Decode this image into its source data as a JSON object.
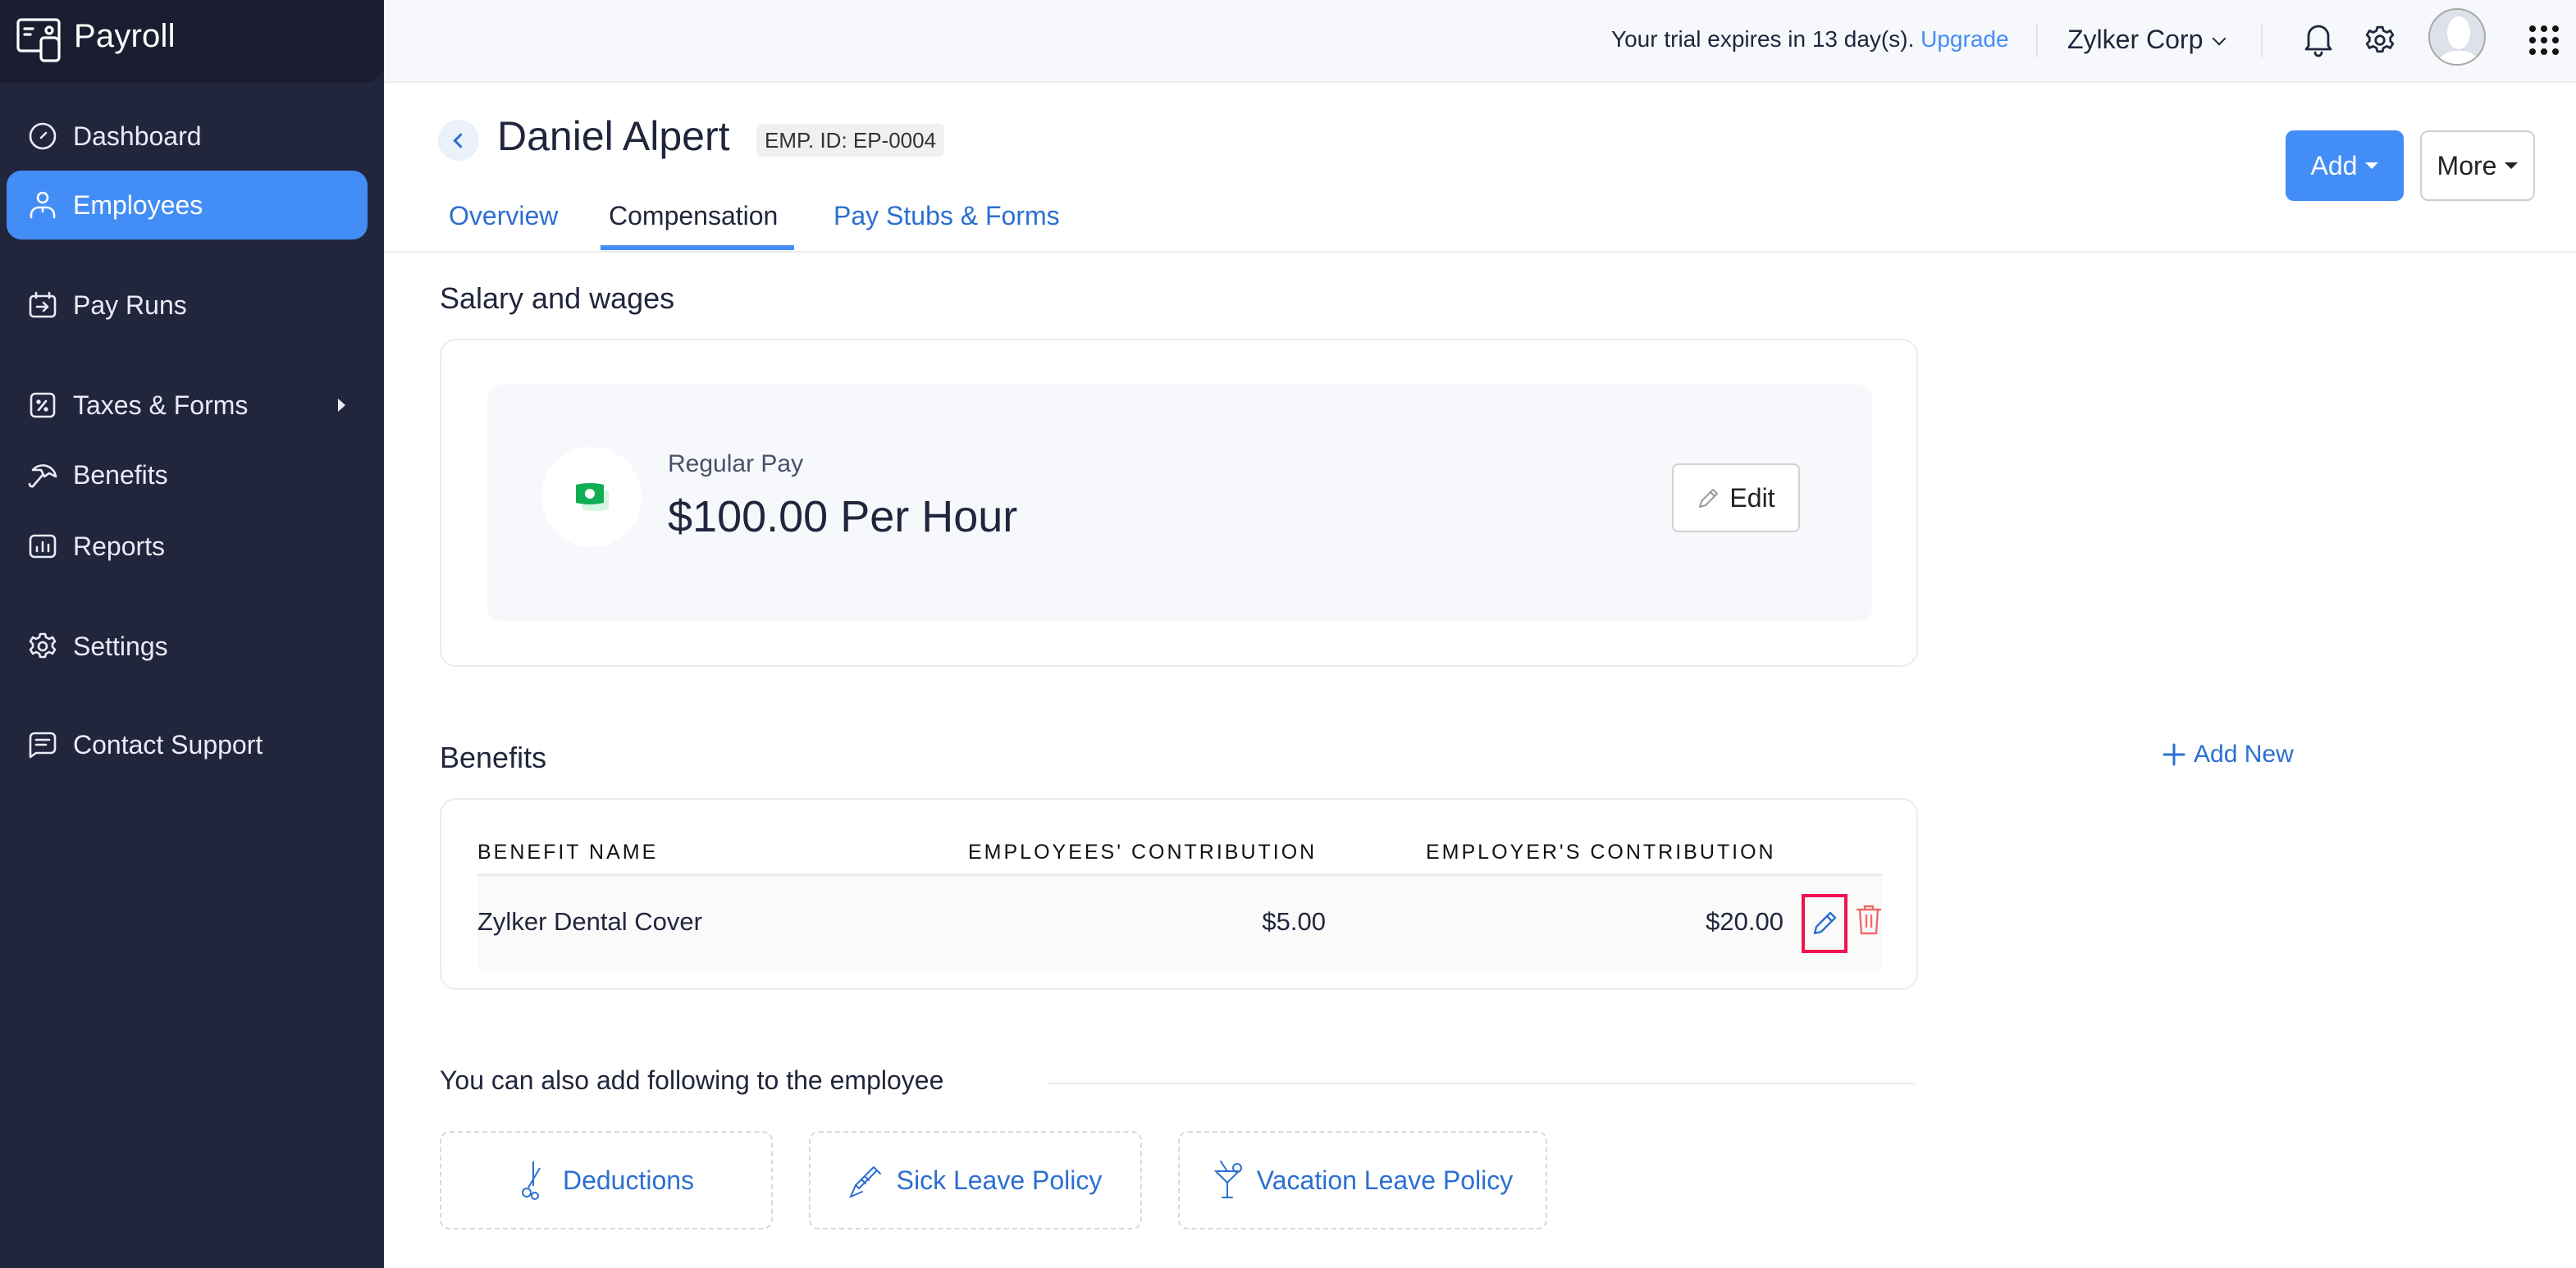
{
  "app": {
    "name": "Payroll"
  },
  "sidebar": {
    "items": [
      {
        "label": "Dashboard",
        "icon": "dashboard-icon"
      },
      {
        "label": "Employees",
        "icon": "person-icon",
        "active": true
      },
      {
        "label": "Pay Runs",
        "icon": "pay-runs-icon"
      },
      {
        "label": "Taxes & Forms",
        "icon": "percent-icon",
        "has_submenu": true
      },
      {
        "label": "Benefits",
        "icon": "umbrella-icon"
      },
      {
        "label": "Reports",
        "icon": "bar-chart-icon"
      },
      {
        "label": "Settings",
        "icon": "gear-icon"
      },
      {
        "label": "Contact Support",
        "icon": "chat-icon"
      }
    ]
  },
  "topbar": {
    "trial_text": "Your trial expires in 13 day(s).",
    "upgrade_label": "Upgrade",
    "organization": "Zylker Corp"
  },
  "employee": {
    "name": "Daniel Alpert",
    "emp_id": "EMP. ID: EP-0004"
  },
  "actions": {
    "add_label": "Add",
    "more_label": "More"
  },
  "tabs": [
    {
      "label": "Overview"
    },
    {
      "label": "Compensation",
      "active": true
    },
    {
      "label": "Pay Stubs & Forms"
    }
  ],
  "salary": {
    "title": "Salary and wages",
    "pay_type": "Regular Pay",
    "pay_value": "$100.00 Per Hour",
    "edit_label": "Edit"
  },
  "benefits": {
    "title": "Benefits",
    "add_new_label": "Add New",
    "columns": [
      "BENEFIT NAME",
      "EMPLOYEES' CONTRIBUTION",
      "EMPLOYER'S CONTRIBUTION"
    ],
    "rows": [
      {
        "name": "Zylker Dental Cover",
        "employee_contribution": "$5.00",
        "employer_contribution": "$20.00"
      }
    ]
  },
  "also_add": {
    "title": "You can also add following to the employee",
    "options": [
      {
        "label": "Deductions",
        "icon": "scissors-icon"
      },
      {
        "label": "Sick Leave Policy",
        "icon": "syringe-icon"
      },
      {
        "label": "Vacation Leave Policy",
        "icon": "cocktail-icon"
      }
    ]
  },
  "colors": {
    "accent": "#428df6",
    "link": "#2b6fd0",
    "sidebar_bg": "#21263c",
    "brand_bg": "#1a1e30",
    "highlight": "#f0124f",
    "delete": "#f06b6b",
    "money_green": "#0fae55"
  }
}
